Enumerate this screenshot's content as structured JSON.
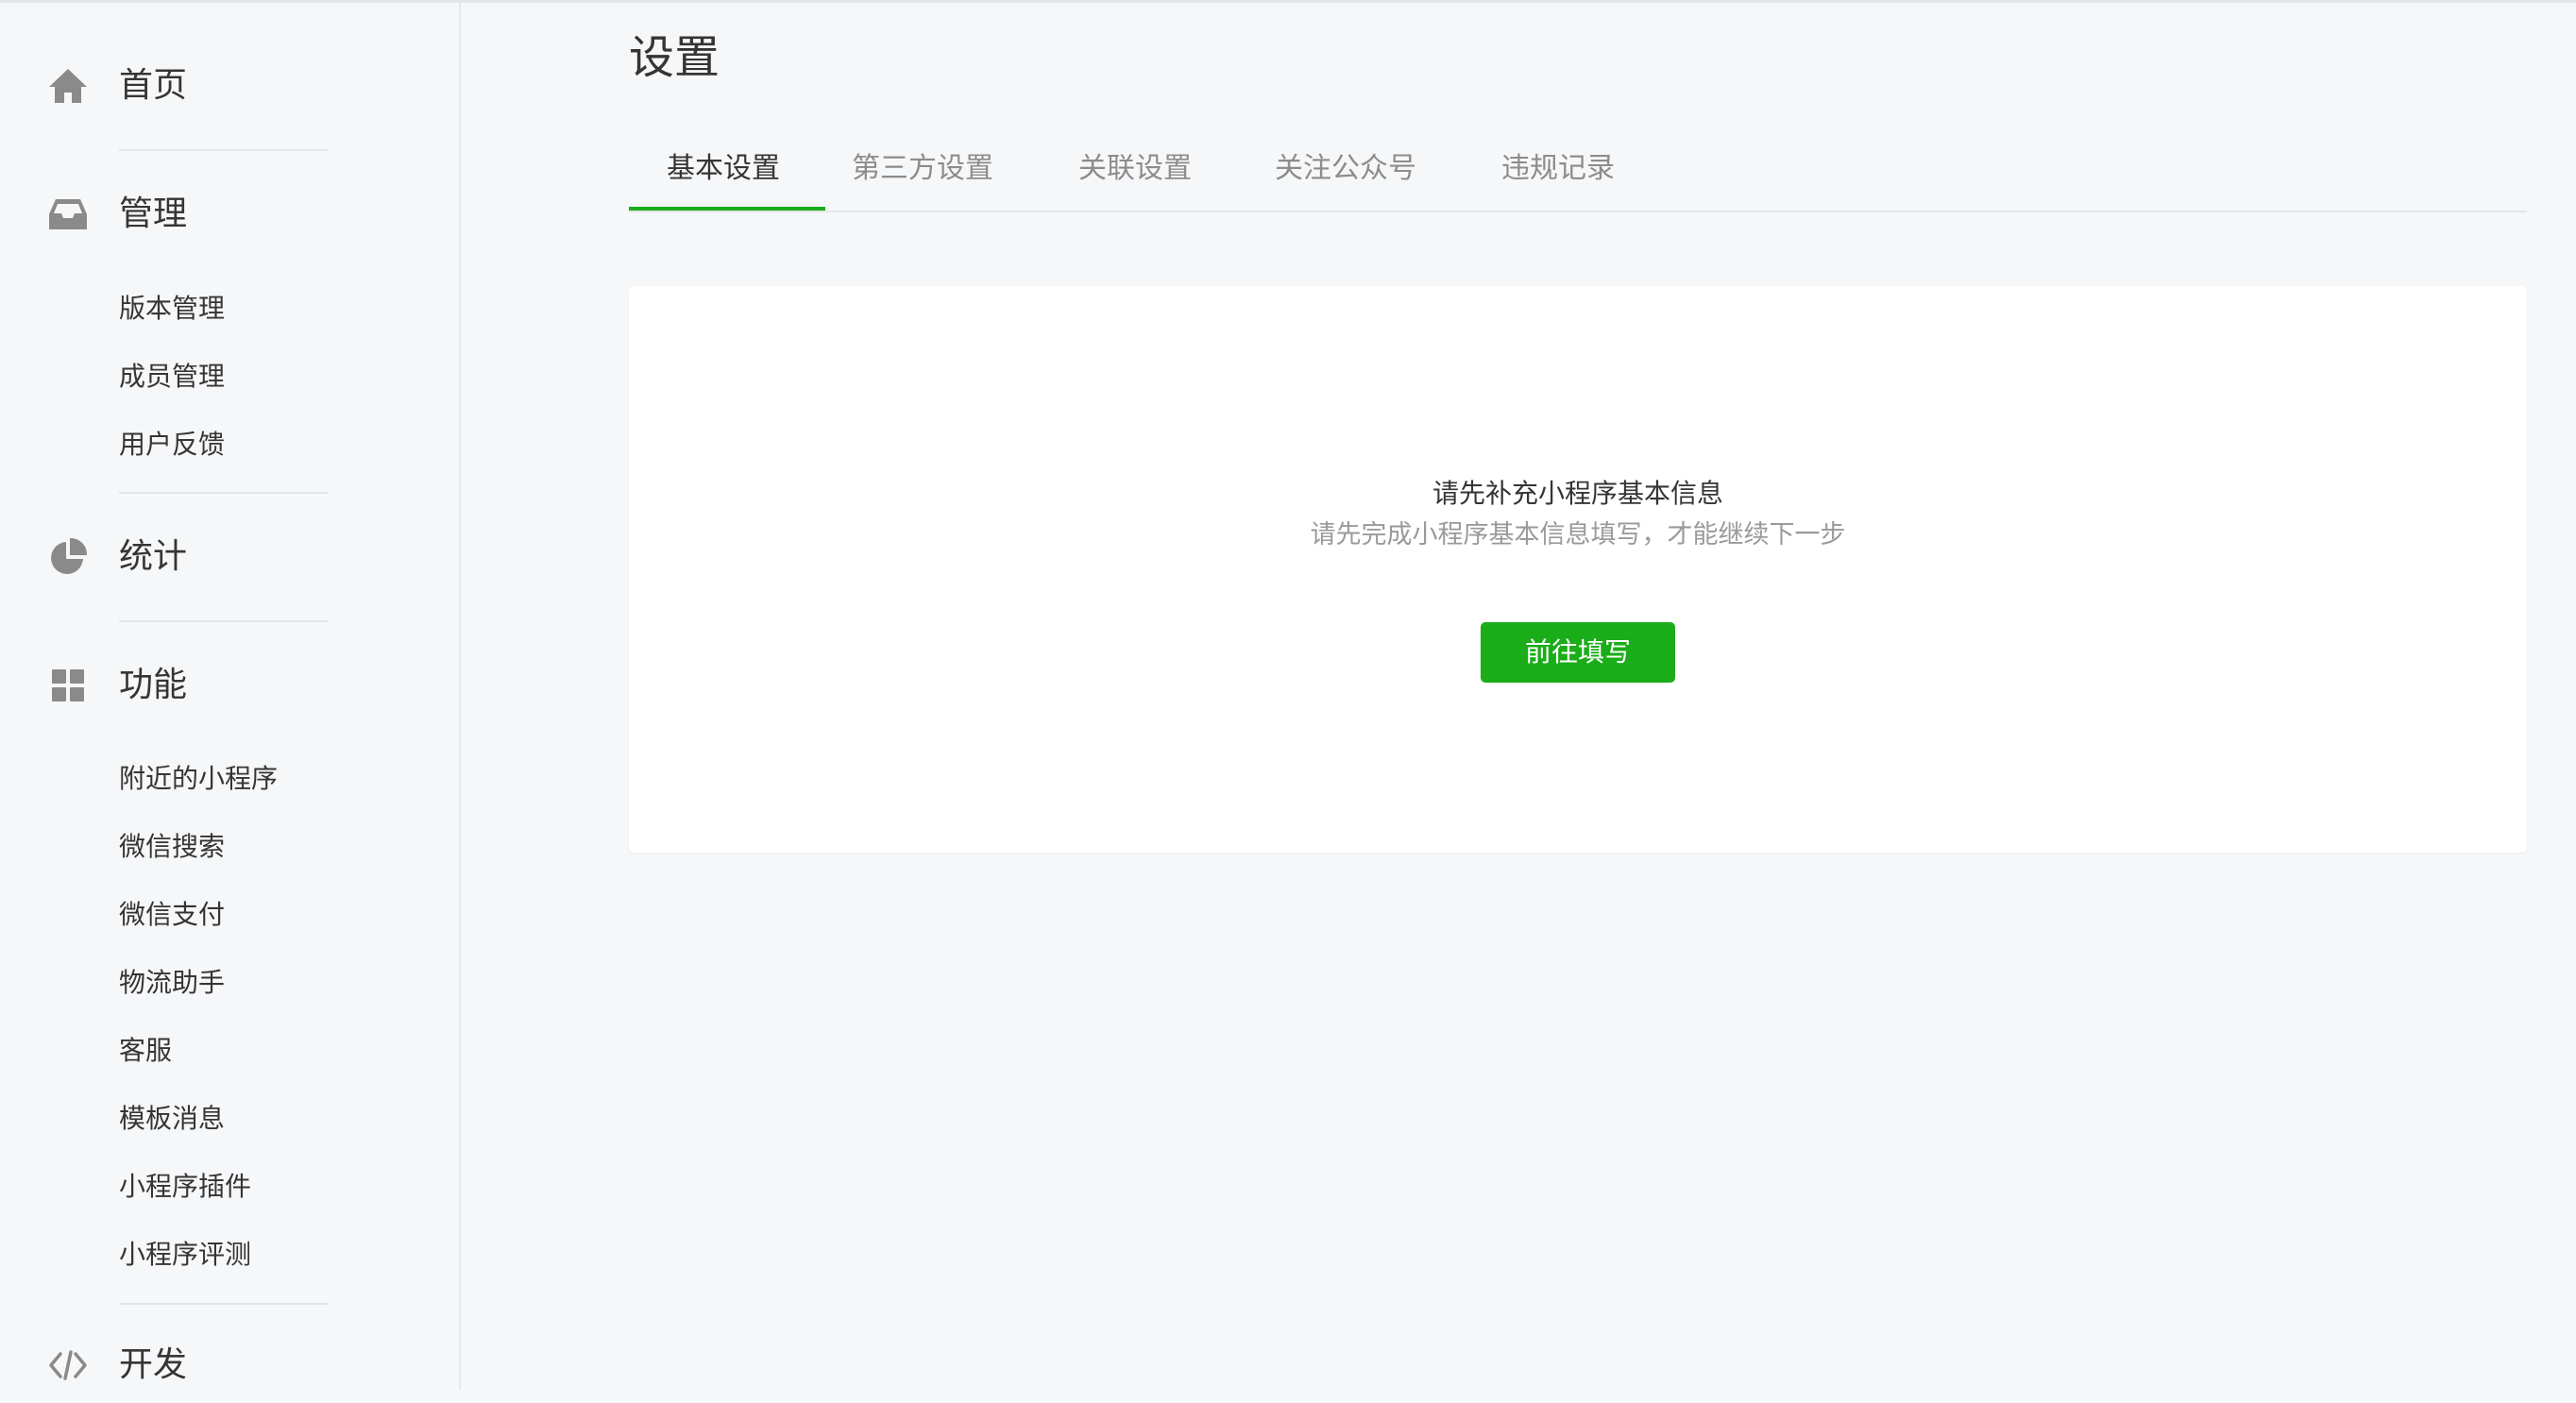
{
  "sidebar": {
    "sections": {
      "home": {
        "label": "首页",
        "icon": "home-icon"
      },
      "manage": {
        "label": "管理",
        "icon": "inbox-icon",
        "items": [
          "版本管理",
          "成员管理",
          "用户反馈"
        ]
      },
      "stats": {
        "label": "统计",
        "icon": "pie-chart-icon"
      },
      "features": {
        "label": "功能",
        "icon": "grid-icon",
        "items": [
          "附近的小程序",
          "微信搜索",
          "微信支付",
          "物流助手",
          "客服",
          "模板消息",
          "小程序插件",
          "小程序评测"
        ]
      },
      "dev": {
        "label": "开发",
        "icon": "code-icon"
      }
    }
  },
  "main": {
    "title": "设置",
    "tabs": [
      "基本设置",
      "第三方设置",
      "关联设置",
      "关注公众号",
      "违规记录"
    ],
    "active_tab": "基本设置",
    "card": {
      "title": "请先补充小程序基本信息",
      "description": "请先完成小程序基本信息填写，才能继续下一步",
      "button_label": "前往填写"
    }
  },
  "colors": {
    "accent": "#1aad19",
    "text": "#353535",
    "muted": "#9a9a9a",
    "icon": "#8a8a8a",
    "background": "#f6f7f9"
  }
}
